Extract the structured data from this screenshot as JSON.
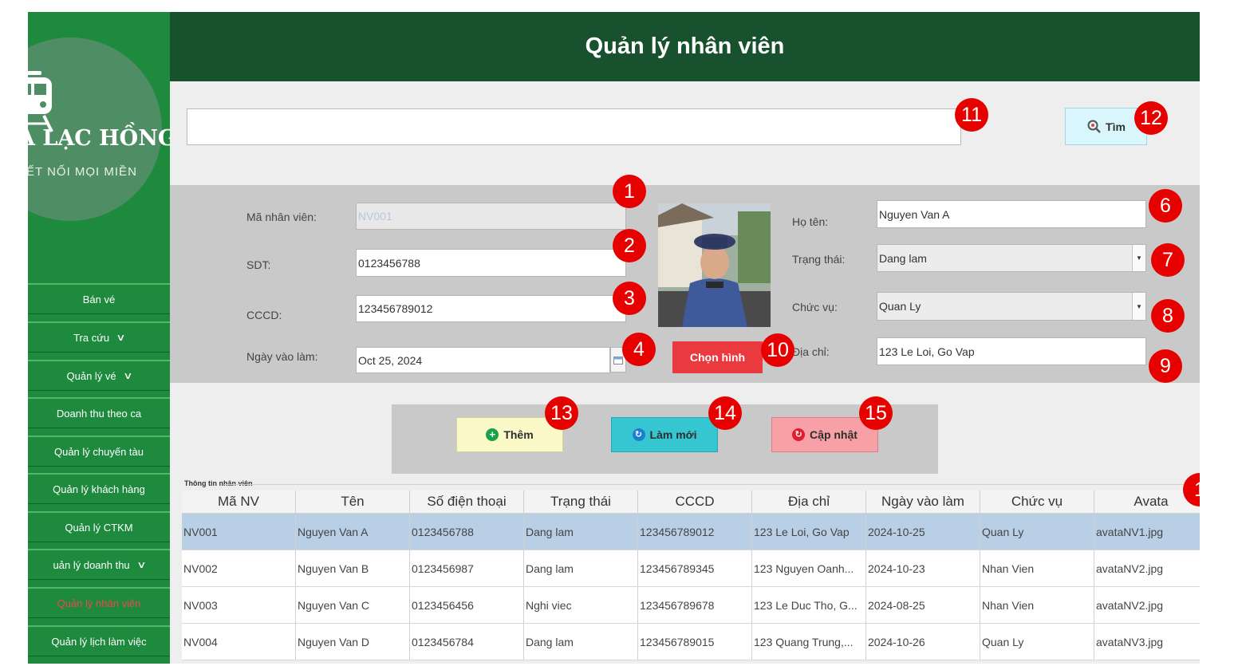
{
  "header": {
    "title": "Quản lý nhân viên"
  },
  "logo": {
    "title": "A LẠC HỒNG",
    "subtitle": "ẾT NỐI MỌI MIỀN"
  },
  "sidebar": {
    "items": [
      {
        "label": "Bán vé",
        "chevron": false
      },
      {
        "label": "Tra cứu",
        "chevron": true
      },
      {
        "label": "Quản lý vé",
        "chevron": true
      },
      {
        "label": "Doanh thu theo ca",
        "chevron": false
      },
      {
        "label": "Quản lý chuyến tàu",
        "chevron": false
      },
      {
        "label": "Quản lý khách hàng",
        "chevron": false
      },
      {
        "label": "Quản lý CTKM",
        "chevron": false
      },
      {
        "label": "uản lý doanh thu",
        "chevron": true
      },
      {
        "label": "Quản lý nhân viên",
        "chevron": false,
        "active": true
      },
      {
        "label": "Quản lý lịch làm việc",
        "chevron": false
      }
    ],
    "chevron_glyph": "∨"
  },
  "search": {
    "value": "",
    "button_label": "Tìm"
  },
  "form": {
    "ma_nv": {
      "label": "Mã nhân viên:",
      "value": "NV001"
    },
    "sdt": {
      "label": "SDT:",
      "value": "0123456788"
    },
    "cccd": {
      "label": "CCCD:",
      "value": "123456789012"
    },
    "ngay_vao_lam": {
      "label": "Ngày vào làm:",
      "value": "Oct 25, 2024"
    },
    "ho_ten": {
      "label": "Họ tên:",
      "value": "Nguyen Van A"
    },
    "trang_thai": {
      "label": "Trạng thái:",
      "value": "Dang lam"
    },
    "chuc_vu": {
      "label": "Chức vụ:",
      "value": "Quan Ly"
    },
    "dia_chi": {
      "label": "Địa chỉ:",
      "value": "123 Le Loi, Go Vap"
    },
    "choose_image_label": "Chọn hình"
  },
  "actions": {
    "add_label": "Thêm",
    "refresh_label": "Làm mới",
    "update_label": "Cập nhật"
  },
  "table": {
    "caption": "Thông tin nhân viên",
    "columns": [
      "Mã NV",
      "Tên",
      "Số điện thoại",
      "Trạng thái",
      "CCCD",
      "Địa chỉ",
      "Ngày vào làm",
      "Chức vụ",
      "Avata"
    ],
    "rows": [
      [
        "NV001",
        "Nguyen Van A",
        "0123456788",
        "Dang lam",
        "123456789012",
        "123 Le Loi, Go Vap",
        "2024-10-25",
        "Quan Ly",
        "avataNV1.jpg"
      ],
      [
        "NV002",
        "Nguyen Van B",
        "0123456987",
        "Dang lam",
        "123456789345",
        "123 Nguyen Oanh...",
        "2024-10-23",
        "Nhan Vien",
        "avataNV2.jpg"
      ],
      [
        "NV003",
        "Nguyen Van C",
        "0123456456",
        "Nghi viec",
        "123456789678",
        "123 Le Duc Tho, G...",
        "2024-08-25",
        "Nhan Vien",
        "avataNV2.jpg"
      ],
      [
        "NV004",
        "Nguyen Van D",
        "0123456784",
        "Dang lam",
        "123456789015",
        "123 Quang Trung,...",
        "2024-10-26",
        "Quan Ly",
        "avataNV3.jpg"
      ]
    ]
  },
  "markers": [
    "1",
    "2",
    "3",
    "4",
    "6",
    "7",
    "8",
    "9",
    "10",
    "11",
    "12",
    "13",
    "14",
    "15",
    "1"
  ],
  "colors": {
    "sidebar": "#1e8a3e",
    "header": "#17512d",
    "marker": "#e60000",
    "choose_button": "#ea3a3f",
    "selected_row": "#b8cfe5"
  }
}
